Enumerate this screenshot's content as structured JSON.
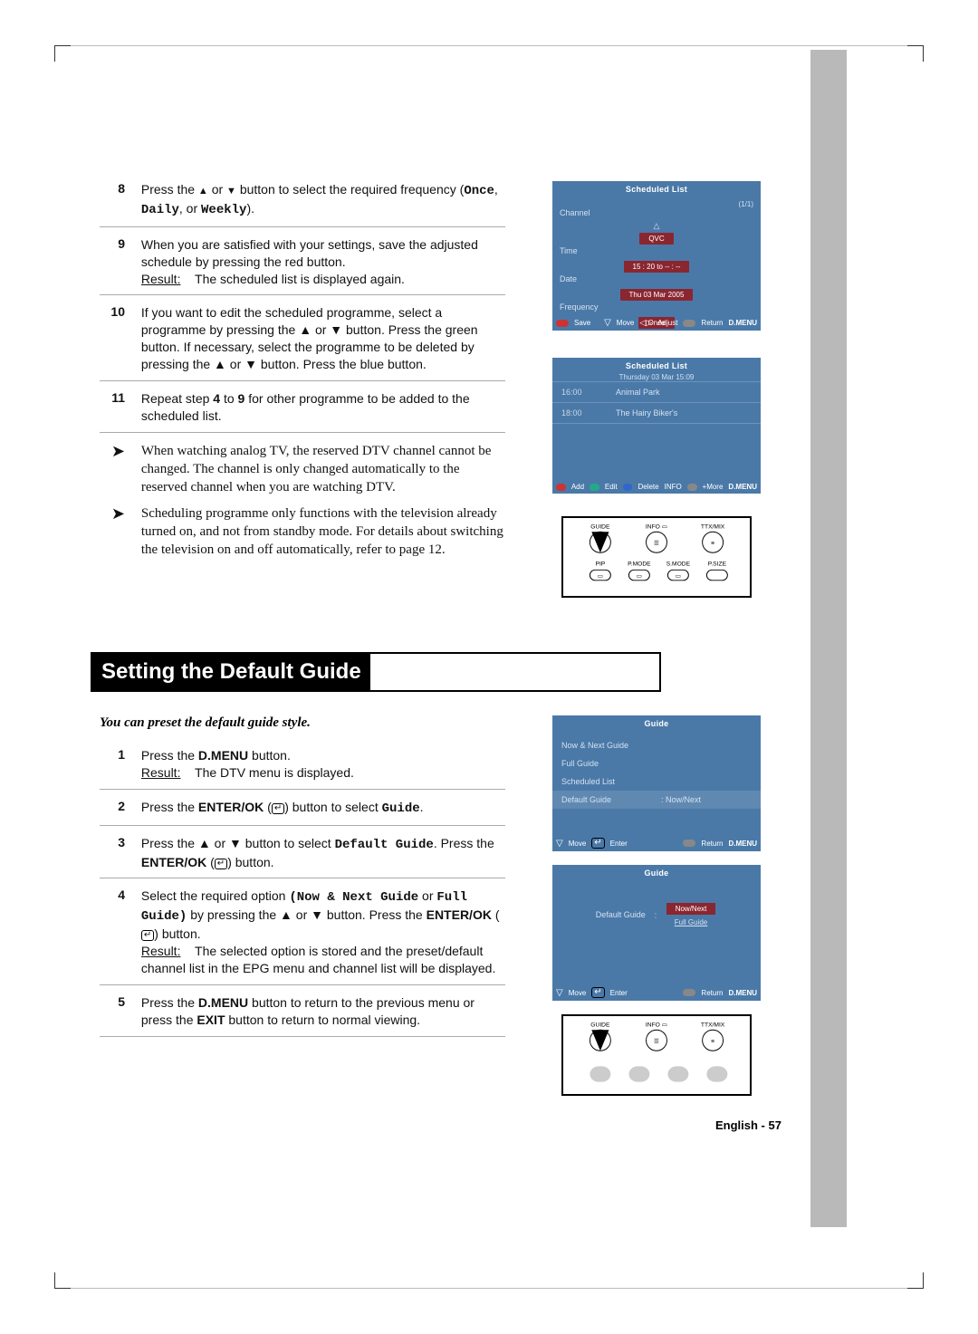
{
  "steps_a": {
    "s8": {
      "n": "8",
      "t1": "Press the ",
      "t2": " or ",
      "t3": " button to select the required frequency (",
      "once": "Once",
      "daily": "Daily",
      "or": ", or ",
      "weekly": "Weekly",
      "end": ")."
    },
    "s9": {
      "n": "9",
      "t1": "When you are satisfied with your settings, save the adjusted schedule by pressing the red button.",
      "rlabel": "Result:",
      "r": "The scheduled list is displayed again."
    },
    "s10": {
      "n": "10",
      "t": "If you want to edit the scheduled programme, select a programme by pressing the ▲ or ▼ button. Press the green button. If necessary, select the programme to be deleted by pressing the ▲ or ▼ button. Press the blue button."
    },
    "s11": {
      "n": "11",
      "t1": "Repeat step ",
      "four": "4",
      "to": " to ",
      "nine": "9",
      "t2": " for other programme to be added to the scheduled list."
    }
  },
  "notes": {
    "n1": "When watching analog TV, the reserved DTV channel cannot be changed. The channel is only changed automatically to the reserved channel when you are watching DTV.",
    "n2": "Scheduling programme only functions with the television already turned on, and not from standby mode. For details about switching the television on and off automatically, refer to page 12."
  },
  "section_title": "Setting the Default Guide",
  "intro": "You can preset the default guide style.",
  "steps_b": {
    "s1": {
      "n": "1",
      "t1": "Press the ",
      "dmenu": "D.MENU",
      "t2": " button.",
      "rlabel": "Result:",
      "r": "The DTV menu is displayed."
    },
    "s2": {
      "n": "2",
      "t1": "Press the ",
      "enterok": "ENTER/OK",
      "t2": " (",
      "t3": ") button to select ",
      "guide": "Guide",
      "end": "."
    },
    "s3": {
      "n": "3",
      "t1": "Press the ▲ or ▼ button to select ",
      "dg": "Default Guide",
      "t2": ". Press the ",
      "enterok": "ENTER/OK",
      "t3": " (",
      "t4": ") button."
    },
    "s4": {
      "n": "4",
      "t1": "Select the required option ",
      "nn": "(Now & Next Guide",
      "or": " or ",
      "fg": "Full Guide)",
      "t2": " by pressing the ▲ or ▼ button. Press the ",
      "enterok": "ENTER/OK",
      "t3": " (",
      "t4": ") button.",
      "rlabel": "Result:",
      "r": "The selected option is stored and the preset/default channel list in the EPG menu and channel list will be displayed."
    },
    "s5": {
      "n": "5",
      "t1": "Press the ",
      "dmenu": "D.MENU",
      "t2": " button to return to the previous menu or press the ",
      "exit": "EXIT",
      "t3": " button to return to normal viewing."
    }
  },
  "screens": {
    "sched": {
      "title": "Scheduled List",
      "line1": "(1/1)",
      "ch_label": "Channel",
      "ch": "QVC",
      "time_label": "Time",
      "time": "15 : 20 to -- : --",
      "date_label": "Date",
      "date": "Thu 03 Mar 2005",
      "freq_label": "Frequency",
      "freq": "Once",
      "foot_save": "Save",
      "foot_move": "Move",
      "foot_adj": "Adjust",
      "foot_ret": "Return",
      "foot_dmenu": "D.MENU"
    },
    "list": {
      "title": "Scheduled List",
      "date": "Thursday 03 Mar  15:09",
      "r1t": "16:00",
      "r1n": "Animal Park",
      "r2t": "18:00",
      "r2n": "The Hairy Biker's",
      "foot_add": "Add",
      "foot_edit": "Edit",
      "foot_del": "Delete",
      "foot_info": "INFO",
      "foot_more": "+More",
      "foot_dmenu": "D.MENU"
    },
    "guide_menu": {
      "title": "Guide",
      "items": [
        {
          "k": "Now & Next Guide",
          "v": ""
        },
        {
          "k": "Full Guide",
          "v": ""
        },
        {
          "k": "Scheduled List",
          "v": ""
        },
        {
          "k": "Default Guide",
          "v": ": Now/Next",
          "sel": true
        }
      ],
      "foot_move": "Move",
      "foot_enter": "Enter",
      "foot_ret": "Return",
      "foot_dmenu": "D.MENU"
    },
    "guide_opt": {
      "title": "Guide",
      "label": "Default Guide",
      "sep": ":",
      "opt1": "Now/Next",
      "opt2": "Full Guide",
      "foot_move": "Move",
      "foot_enter": "Enter",
      "foot_ret": "Return",
      "foot_dmenu": "D.MENU"
    }
  },
  "remote": {
    "guide": "GUIDE",
    "info": "INFO",
    "ttx": "TTX/MIX",
    "pip": "PIP",
    "pmode": "P.MODE",
    "smode": "S.MODE",
    "psize": "P.SIZE"
  },
  "footer": "English - 57"
}
